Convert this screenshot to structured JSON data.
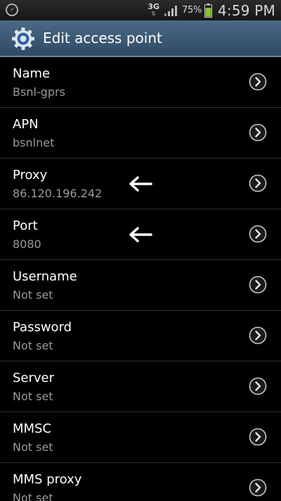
{
  "status_bar": {
    "network_type": "3G",
    "network_arrows": "⇅",
    "battery_percent": "75%",
    "battery_level": 0.75,
    "time": "4:59 PM"
  },
  "header": {
    "title": "Edit access point",
    "icon": "settings-gear-icon"
  },
  "accent_color": "#36506a",
  "settings": [
    {
      "title": "Name",
      "summary": "Bsnl-gprs"
    },
    {
      "title": "APN",
      "summary": "bsnlnet"
    },
    {
      "title": "Proxy",
      "summary": "86.120.196.242"
    },
    {
      "title": "Port",
      "summary": "8080"
    },
    {
      "title": "Username",
      "summary": "Not set"
    },
    {
      "title": "Password",
      "summary": "Not set"
    },
    {
      "title": "Server",
      "summary": "Not set"
    },
    {
      "title": "MMSC",
      "summary": "Not set"
    },
    {
      "title": "MMS proxy",
      "summary": "Not set"
    }
  ],
  "annotations": {
    "icon": "left-arrow-icon",
    "marked_rows": [
      "Proxy",
      "Port"
    ]
  }
}
